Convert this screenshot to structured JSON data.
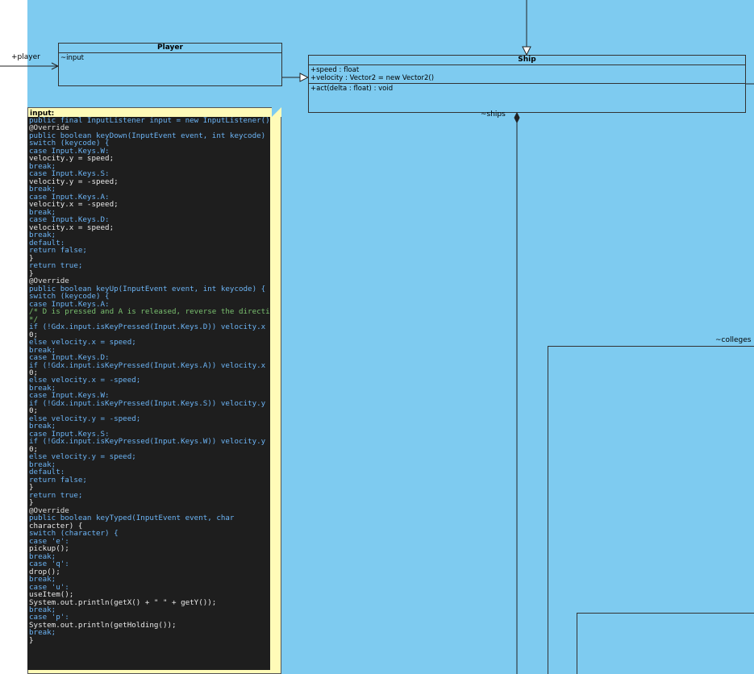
{
  "diagram": {
    "background_color": "#7ecbf0",
    "player_class": {
      "name": "Player",
      "attributes": [
        "~input"
      ]
    },
    "ship_class": {
      "name": "Ship",
      "attributes": [
        "+speed : float",
        "+velocity : Vector2 = new Vector2()"
      ],
      "operations": [
        "+act(delta : float) : void"
      ]
    },
    "labels": {
      "player_role": "+player",
      "ships_role": "~ships",
      "colleges_role": "~colleges"
    },
    "note": {
      "title": "input:",
      "lines": [
        "public final InputListener input = new InputListener() {",
        "@Override",
        "public boolean keyDown(InputEvent event, int keycode) {",
        "switch (keycode) {",
        "case Input.Keys.W:",
        "velocity.y = speed;",
        "break;",
        "case Input.Keys.S:",
        "velocity.y = -speed;",
        "break;",
        "case Input.Keys.A:",
        "velocity.x = -speed;",
        "break;",
        "case Input.Keys.D:",
        "velocity.x = speed;",
        "break;",
        "default:",
        "return false;",
        "}",
        "return true;",
        "}",
        "",
        "@Override",
        "public boolean keyUp(InputEvent event, int keycode) {",
        "switch (keycode) {",
        "case Input.Keys.A:",
        "/* D is pressed and A is released, reverse the direction",
        "*/",
        "if (!Gdx.input.isKeyPressed(Input.Keys.D)) velocity.x =",
        "0;",
        "else velocity.x = speed;",
        "break;",
        "case Input.Keys.D:",
        "if (!Gdx.input.isKeyPressed(Input.Keys.A)) velocity.x =",
        "0;",
        "else velocity.x = -speed;",
        "break;",
        "case Input.Keys.W:",
        "if (!Gdx.input.isKeyPressed(Input.Keys.S)) velocity.y =",
        "0;",
        "else velocity.y = -speed;",
        "break;",
        "case Input.Keys.S:",
        "if (!Gdx.input.isKeyPressed(Input.Keys.W)) velocity.y =",
        "0;",
        "else velocity.y = speed;",
        "break;",
        "default:",
        "return false;",
        "}",
        "return true;",
        "}",
        "",
        "@Override",
        "public boolean keyTyped(InputEvent event, char",
        "character) {",
        "switch (character) {",
        "case 'e':",
        "pickup();",
        "break;",
        "case 'q':",
        "drop();",
        "break;",
        "case 'u':",
        "useItem();",
        "System.out.println(getX() + \" \" + getY());",
        "break;",
        "case 'p':",
        "System.out.println(getHolding());",
        "break;",
        "",
        "}"
      ],
      "line_styles": [
        "kw",
        "an",
        "kw",
        "kw",
        "kw",
        "",
        "kw",
        "kw",
        "",
        "kw",
        "kw",
        "",
        "kw",
        "kw",
        "",
        "kw",
        "kw",
        "kw",
        "",
        "kw",
        "",
        "",
        "an",
        "kw",
        "kw",
        "kw",
        "cm",
        "cm",
        "kw",
        "",
        "kw",
        "kw",
        "kw",
        "kw",
        "",
        "kw",
        "kw",
        "kw",
        "kw",
        "",
        "kw",
        "kw",
        "kw",
        "kw",
        "",
        "kw",
        "kw",
        "kw",
        "kw",
        "",
        "kw",
        "",
        "",
        "an",
        "kw",
        "",
        "kw",
        "kw",
        "",
        "kw",
        "kw",
        "",
        "kw",
        "kw",
        "",
        "",
        "kw",
        "kw",
        "",
        "kw",
        "",
        ""
      ]
    }
  }
}
